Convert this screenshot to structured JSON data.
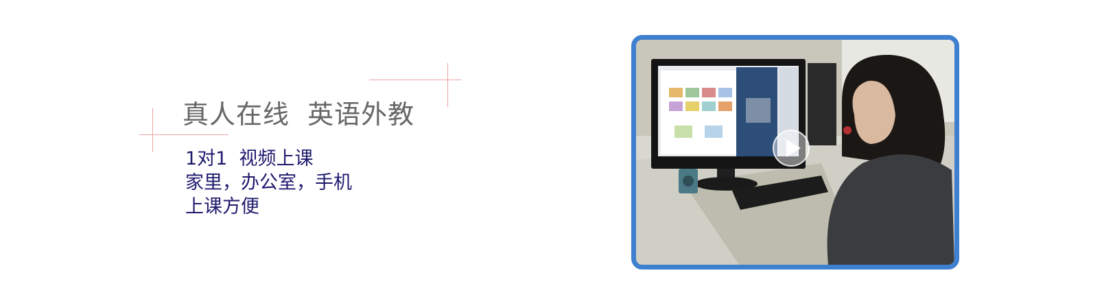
{
  "headline": "真人在线  英语外教",
  "subtext": {
    "lines": [
      "1对1  视频上课",
      "家里，办公室，手机",
      "上课方便"
    ]
  },
  "video": {
    "play_icon": "play-icon",
    "accent_border": "#3f7fd0"
  },
  "colors": {
    "headline": "#666666",
    "subtext": "#1e1a6e",
    "deco_line": "#e8a3a3"
  }
}
